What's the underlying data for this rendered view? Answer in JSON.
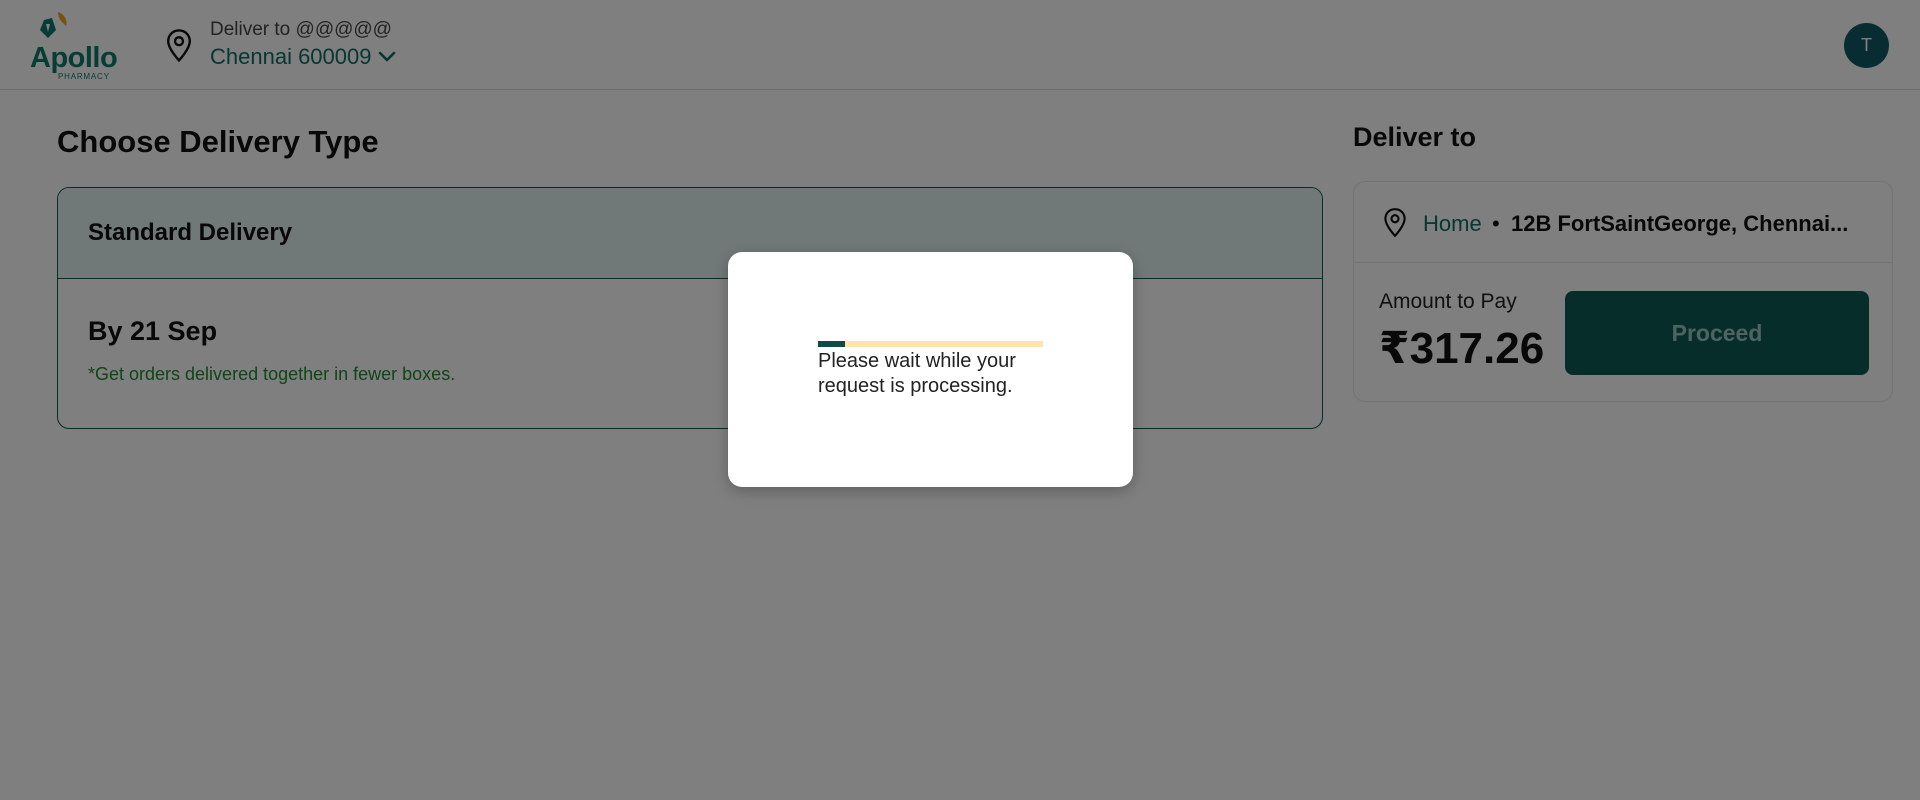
{
  "header": {
    "logo": {
      "word": "Apollo",
      "sub": "PHARMACY",
      "brand_color": "#0f7a6b",
      "icon": "apollo-logo-icon"
    },
    "deliver_label": "Deliver to @@@@@",
    "city": "Chennai 600009",
    "city_icon": "chevron-down-icon",
    "location_icon": "location-pin-icon",
    "avatar_initial": "T"
  },
  "main": {
    "title": "Choose Delivery Type",
    "option": {
      "name": "Standard Delivery",
      "date": "By 21 Sep",
      "note": "*Get orders delivered together in fewer boxes."
    }
  },
  "sidebar": {
    "title": "Deliver to",
    "address_type": "Home",
    "separator": "•",
    "address": "12B FortSaintGeorge, Chennai...",
    "amount_label": "Amount to Pay",
    "amount": "₹317.26",
    "proceed_label": "Proceed"
  },
  "modal": {
    "message": "Please wait while your request is processing.",
    "progress_fraction": 0.12,
    "progress_color": "#0f4a47",
    "track_color": "#fde5a8"
  },
  "colors": {
    "accent": "#0f6e62",
    "button": "#0f5a55",
    "note_green": "#1e8a2e"
  }
}
